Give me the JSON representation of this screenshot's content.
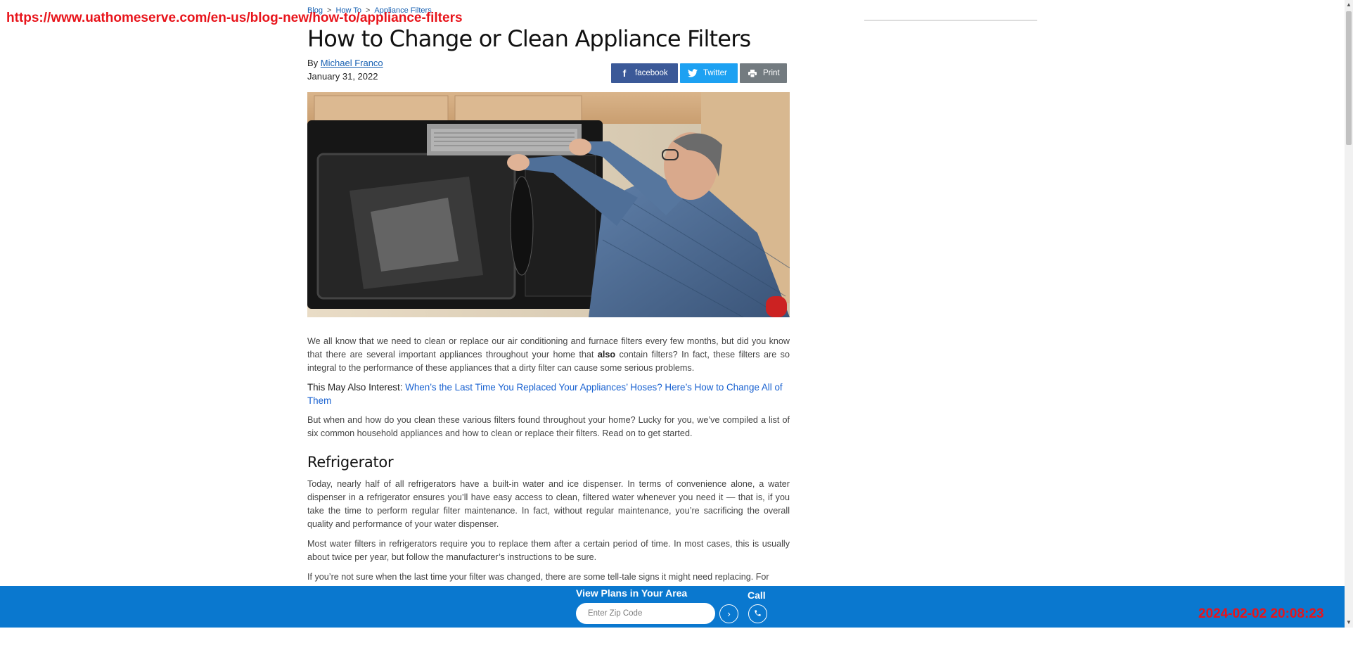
{
  "overlay": {
    "url": "https://www.uathomeserve.com/en-us/blog-new/how-to/appliance-filters",
    "timestamp": "2024-02-02 20:08:23"
  },
  "breadcrumb": [
    "Blog",
    "How To",
    "Appliance Filters"
  ],
  "breadcrumb_separator": ">",
  "article": {
    "title": "How to Change or Clean Appliance Filters",
    "by_prefix": "By",
    "author": "Michael Franco",
    "date": "January 31, 2022",
    "share": {
      "facebook": "facebook",
      "twitter": "Twitter",
      "print": "Print"
    },
    "intro_p1_a": "We all know that we need to clean or replace our air conditioning and furnace filters every few months, but did you know that there are several important appliances throughout your home that ",
    "intro_p1_bold": "also",
    "intro_p1_b": " contain filters? In fact, these filters are so integral to the performance of these appliances that a dirty filter can cause some serious problems.",
    "interest_label": "This May Also Interest:",
    "interest_link": "When’s the Last Time You Replaced Your Appliances’ Hoses? Here’s How to Change All of Them",
    "intro_p2": "But when and how do you clean these various filters found throughout your home? Lucky for you, we’ve compiled a list of six common household appliances and how to clean or replace their filters. Read on to get started.",
    "section1_heading": "Refrigerator",
    "section1_p1": "Today, nearly half of all refrigerators have a built-in water and ice dispenser. In terms of convenience alone, a water dispenser in a refrigerator ensures you’ll have easy access to clean, filtered water whenever you need it — that is, if you take the time to perform regular filter maintenance. In fact, without regular maintenance, you’re sacrificing the overall quality and performance of your water dispenser.",
    "section1_p2": "Most water filters in refrigerators require you to replace them after a certain period of time. In most cases, this is usually about twice per year, but follow the manufacturer’s instructions to be sure.",
    "section1_p3": "If you’re not sure when the last time your filter was changed, there are some tell-tale signs it might need replacing. For"
  },
  "plans_bar": {
    "title": "View Plans in Your Area",
    "zip_placeholder": "Enter Zip Code",
    "zip_value": "",
    "call_label": "Call"
  },
  "colors": {
    "link": "#1760b2",
    "facebook": "#3b5998",
    "twitter": "#1da1f2",
    "print": "#737b80",
    "plans_bar": "#0a78cf",
    "overlay_red": "#e8141b"
  },
  "icons": {
    "facebook": "facebook-f-icon",
    "twitter": "twitter-bird-icon",
    "print": "printer-icon",
    "go": "chevron-right-icon",
    "call": "phone-icon"
  }
}
